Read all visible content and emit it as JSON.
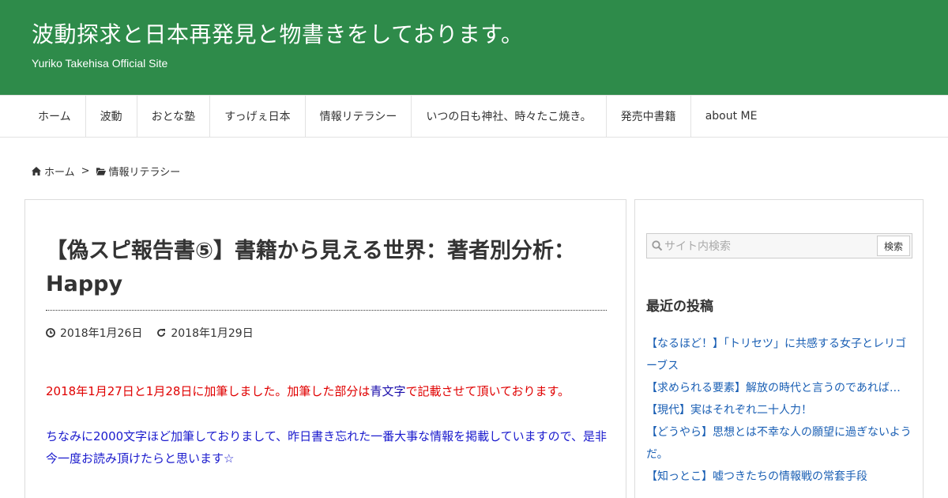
{
  "header": {
    "title": "波動探求と日本再発見と物書きをしております。",
    "description": "Yuriko Takehisa Official Site"
  },
  "nav": {
    "items": [
      "ホーム",
      "波動",
      "おとな塾",
      "すっげぇ日本",
      "情報リテラシー",
      "いつの日も神社、時々たこ焼き。",
      "発売中書籍",
      "about ME"
    ]
  },
  "breadcrumb": {
    "home": "ホーム",
    "separator": ">",
    "category": "情報リテラシー"
  },
  "article": {
    "title": "【偽スピ報告書⑤】書籍から見える世界：著者別分析：Happy",
    "published": "2018年1月26日",
    "updated": "2018年1月29日",
    "p1_red_a": "2018年1月27日と1月28日に加筆しました。加筆した部分は",
    "p1_blue": "青文字",
    "p1_red_b": "で記載させて頂いております。",
    "p2": "ちなみに2000文字ほど加筆しておりまして、昨日書き忘れた一番大事な情報を掲載していますので、是非今一度お読み頂けたらと思います☆"
  },
  "sidebar": {
    "search_placeholder": "サイト内検索",
    "search_button": "検索",
    "recent_heading": "最近の投稿",
    "recent_posts": [
      "【なるほど！】「トリセツ」に共感する女子とレリゴーブス",
      "【求められる要素】解放の時代と言うのであれば…",
      "【現代】実はそれぞれ二十人力！",
      "【どうやら】思想とは不幸な人の願望に過ぎないようだ。",
      "【知っとこ】嘘つきたちの情報戦の常套手段"
    ]
  },
  "colors": {
    "header_bg": "#2e8b4a",
    "red_text": "#e00000",
    "blue_text": "#1a1acd",
    "link": "#1a5fb4"
  }
}
